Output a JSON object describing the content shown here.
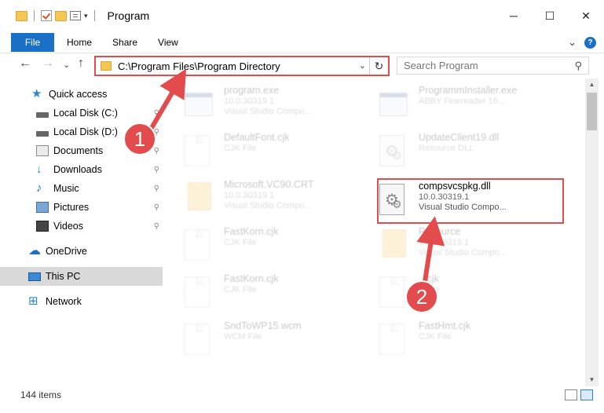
{
  "window": {
    "title": "Program",
    "minimize": "─",
    "maximize": "☐",
    "close": "✕"
  },
  "ribbon": {
    "tabs": [
      "File",
      "Home",
      "Share",
      "View"
    ],
    "expand": "⌄",
    "help": "?"
  },
  "navigation": {
    "back": "←",
    "forward": "→",
    "recent": "⌄",
    "up": "↑",
    "address": "C:\\Program Files\\Program Directory",
    "address_chevron": "⌄",
    "refresh": "↻",
    "search_placeholder": "Search Program",
    "search_icon": "⚲"
  },
  "sidebar": {
    "items": [
      {
        "label": "Quick access",
        "icon": "star-icon",
        "pinned": false
      },
      {
        "label": "Local Disk (C:)",
        "icon": "drive-icon",
        "pinned": true
      },
      {
        "label": "Local Disk (D:)",
        "icon": "drive-icon",
        "pinned": true
      },
      {
        "label": "Documents",
        "icon": "documents-icon",
        "pinned": true
      },
      {
        "label": "Downloads",
        "icon": "downloads-icon",
        "pinned": true
      },
      {
        "label": "Music",
        "icon": "music-icon",
        "pinned": true
      },
      {
        "label": "Pictures",
        "icon": "pictures-icon",
        "pinned": true
      },
      {
        "label": "Videos",
        "icon": "videos-icon",
        "pinned": true
      },
      {
        "label": "OneDrive",
        "icon": "onedrive-icon",
        "pinned": false
      },
      {
        "label": "This PC",
        "icon": "this-pc-icon",
        "pinned": false,
        "selected": true
      },
      {
        "label": "Network",
        "icon": "network-icon",
        "pinned": false
      }
    ],
    "pin_glyph": "📌"
  },
  "files": [
    {
      "name": "program.exe",
      "line2": "10.0.30319.1",
      "line3": "Visual Studio Compo...",
      "icon": "exe-icon"
    },
    {
      "name": "ProgrammInstaller.exe",
      "line2": "ABBY Finereader 16...",
      "line3": "",
      "icon": "exe-icon"
    },
    {
      "name": "DefaultFont.cjk",
      "line2": "CJK File",
      "line3": "",
      "icon": "document-icon"
    },
    {
      "name": "UpdateClient19.dll",
      "line2": "Resource DLL",
      "line3": "",
      "icon": "dll-icon"
    },
    {
      "name": "Microsoft.VC90.CRT",
      "line2": "10.0.30319.1",
      "line3": "Visual Studio Compo...",
      "icon": "folder-icon"
    },
    {
      "name": "compsvcspkg.dll",
      "line2": "10.0.30319.1",
      "line3": "Visual Studio Compo...",
      "icon": "dll-icon"
    },
    {
      "name": "FastKorn.cjk",
      "line2": "CJK File",
      "line3": "",
      "icon": "document-icon"
    },
    {
      "name": "Resource",
      "line2": "10.0.30319.1",
      "line3": "Visual Studio Compo...",
      "icon": "folder-icon"
    },
    {
      "name": "FastKorn.cjk",
      "line2": "CJK File",
      "line3": "",
      "icon": "document-icon"
    },
    {
      "name": "...cjk",
      "line2": "...File",
      "line3": "",
      "icon": "document-icon"
    },
    {
      "name": "SndToWP15.wcm",
      "line2": "WCM File",
      "line3": "",
      "icon": "document-icon"
    },
    {
      "name": "FastHmt.cjk",
      "line2": "CJK File",
      "line3": "",
      "icon": "document-icon"
    }
  ],
  "status": {
    "item_count": "144 items"
  },
  "annotations": {
    "step1": "1",
    "step2": "2",
    "color": "#e34c4c"
  }
}
